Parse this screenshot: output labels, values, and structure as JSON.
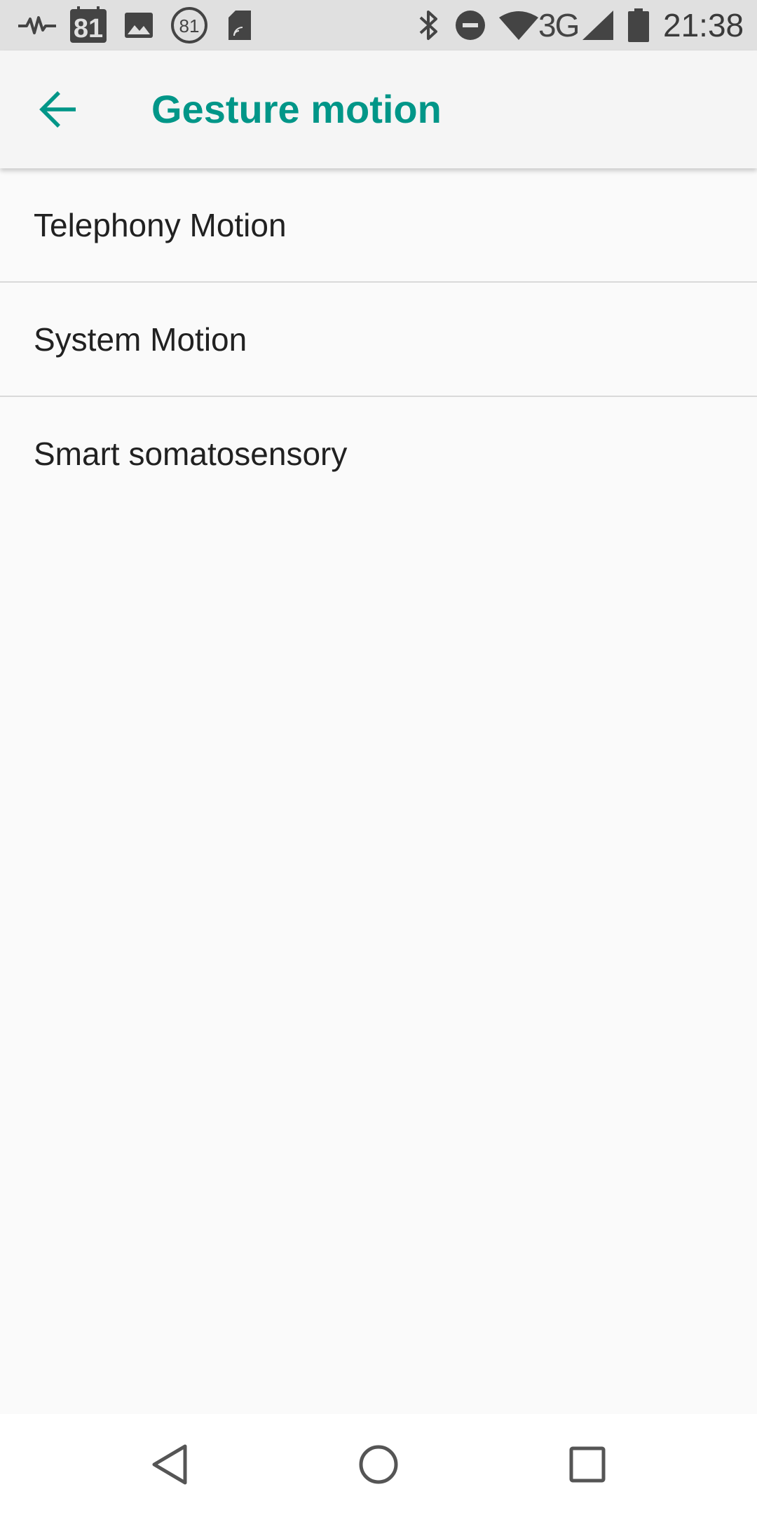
{
  "status_bar": {
    "icons_left": [
      "heartbeat-icon",
      "badge-81-icon",
      "image-icon",
      "circle-81-icon",
      "sd-card-icon"
    ],
    "badge_number": "81",
    "circle_number": "81",
    "icons_right": [
      "bluetooth-icon",
      "do-not-disturb-icon",
      "wifi-icon",
      "cell-signal-icon",
      "battery-icon"
    ],
    "network_type": "3G",
    "time": "21:38"
  },
  "app_bar": {
    "back_icon": "arrow-left-icon",
    "title": "Gesture motion",
    "accent_color": "#009688"
  },
  "list": {
    "items": [
      {
        "label": "Telephony Motion"
      },
      {
        "label": "System Motion"
      },
      {
        "label": "Smart somatosensory"
      }
    ]
  },
  "nav_bar": {
    "icons": [
      "back-triangle-icon",
      "home-circle-icon",
      "recents-square-icon"
    ]
  }
}
